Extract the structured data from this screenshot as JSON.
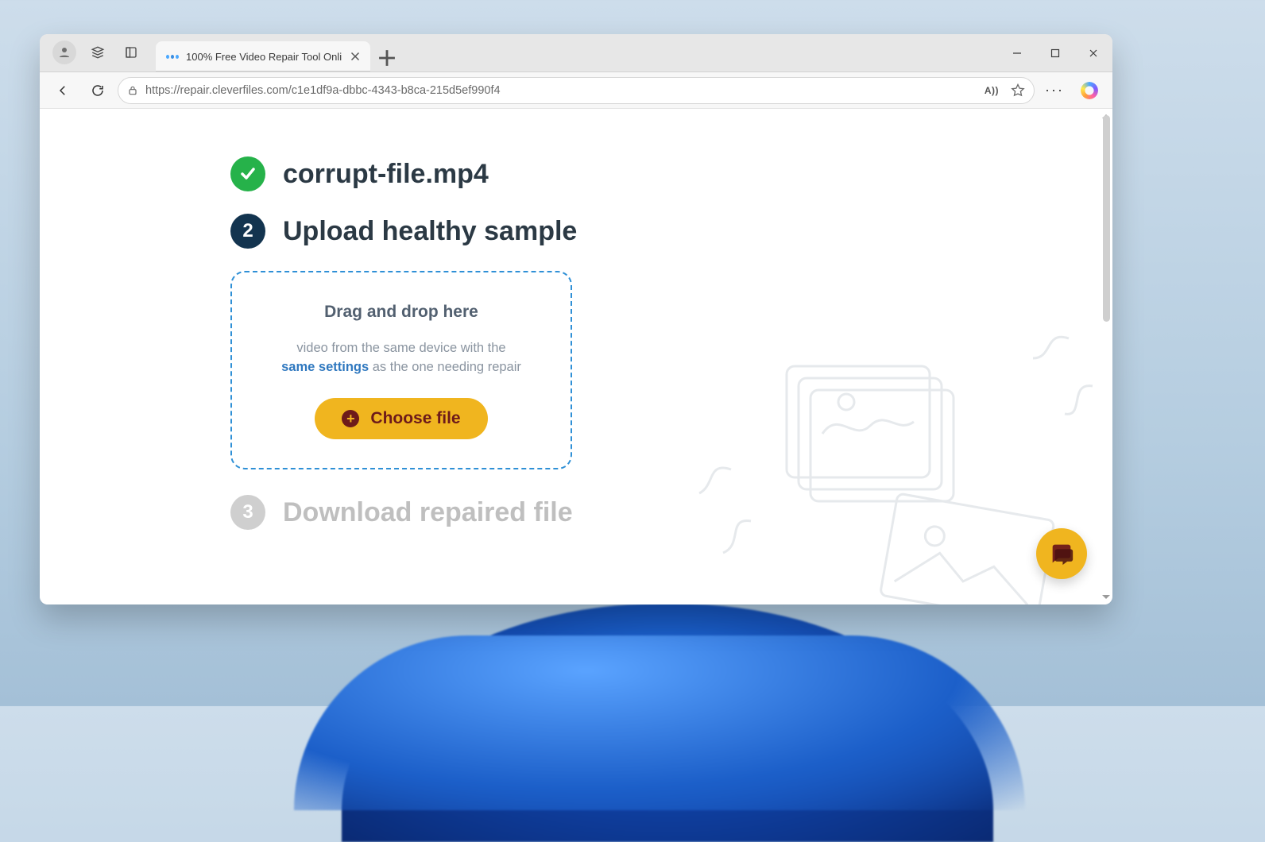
{
  "browser": {
    "tab_title": "100% Free Video Repair Tool Onli",
    "url": "https://repair.cleverfiles.com/c1e1df9a-dbbc-4343-b8ca-215d5ef990f4",
    "read_aloud_label": "A))"
  },
  "steps": {
    "step1": {
      "label": "corrupt-file.mp4",
      "status": "done"
    },
    "step2": {
      "num": "2",
      "label": "Upload healthy sample"
    },
    "step3": {
      "num": "3",
      "label": "Download repaired file"
    }
  },
  "dropzone": {
    "heading": "Drag and drop here",
    "line_pre": "video from the same device with the",
    "link": "same settings",
    "line_post": " as the one needing repair",
    "button": "Choose file"
  }
}
